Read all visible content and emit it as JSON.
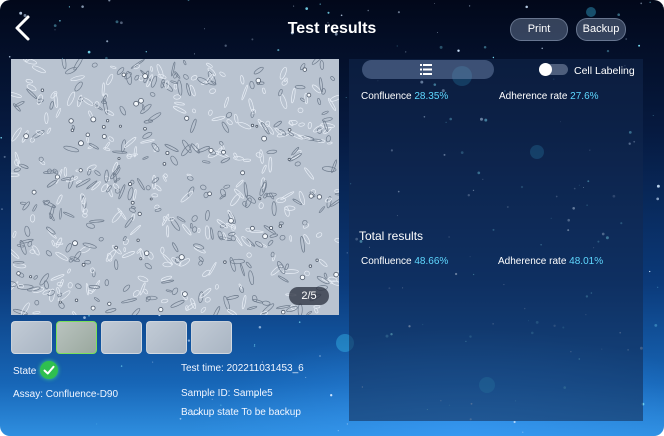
{
  "header": {
    "title": "Test results",
    "print_label": "Print",
    "backup_label": "Backup"
  },
  "image_viewer": {
    "page_indicator": "2/5",
    "thumbnail_count": 5,
    "active_thumbnail": 2
  },
  "info": {
    "state_label": "State",
    "state_icon": "check-circle-icon",
    "assay": "Assay: Confluence-D90",
    "test_time": "Test time: 202211031453_6",
    "sample_id": "Sample ID: Sample5",
    "backup_state": "Backup state To be backup"
  },
  "results": {
    "view_icon": "list-icon",
    "cell_labeling_label": "Cell Labeling",
    "cell_labeling_enabled": false,
    "current": {
      "confluence_label": "Confluence",
      "confluence_value": "28.35%",
      "adherence_label": "Adherence rate",
      "adherence_value": "27.6%"
    },
    "total": {
      "title": "Total results",
      "confluence_label": "Confluence",
      "confluence_value": "48.66%",
      "adherence_label": "Adherence rate",
      "adherence_value": "48.01%"
    }
  },
  "colors": {
    "accent_value": "#5fd8ff",
    "state_ok": "#2fbf4f",
    "thumbnail_active_border": "#7be05b"
  }
}
